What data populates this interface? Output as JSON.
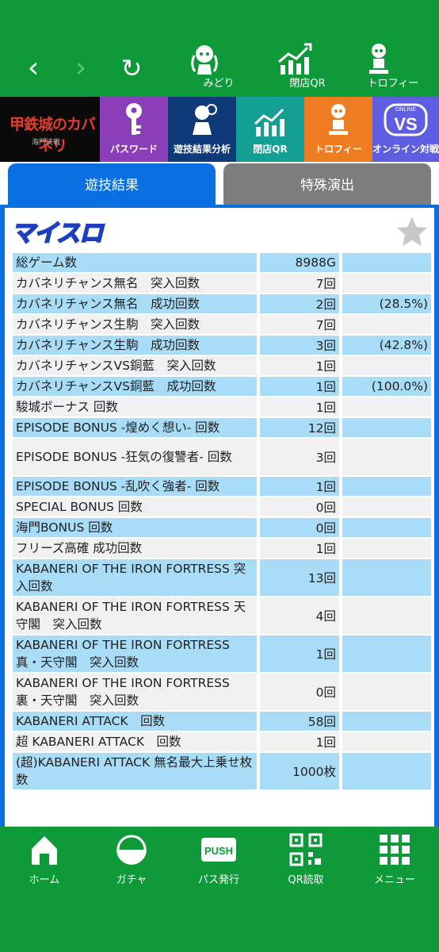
{
  "nav": {
    "back_glyph": "‹",
    "forward_glyph": "›",
    "reload_glyph": "↻"
  },
  "top_icons": [
    {
      "label": "みどり",
      "icon": "character-icon"
    },
    {
      "label": "閉店QR",
      "icon": "chart-icon"
    },
    {
      "label": "トロフィー",
      "icon": "trophy-icon"
    }
  ],
  "menu": {
    "logo_text": "甲鉄城のカバネリ",
    "logo_sub": "海門決戦",
    "tiles": [
      {
        "label": "パスワード",
        "color": "#8a3fb8"
      },
      {
        "label": "遊技結果分析",
        "color": "#0e3a7a"
      },
      {
        "label": "閉店QR",
        "color": "#149f94"
      },
      {
        "label": "トロフィー",
        "color": "#ee7d22"
      },
      {
        "label": "オンライン対戦",
        "color": "#5f5ee3"
      }
    ],
    "vs_text": "VS",
    "online_text": "ONLINE"
  },
  "tabs": {
    "active": "遊技結果",
    "inactive": "特殊演出"
  },
  "brand": "マイスロ",
  "rows": [
    {
      "name": "総ゲーム数",
      "value": "8988G",
      "pct": ""
    },
    {
      "name": "カバネリチャンス無名　突入回数",
      "value": "7回",
      "pct": ""
    },
    {
      "name": "カバネリチャンス無名　成功回数",
      "value": "2回",
      "pct": "(28.5%)"
    },
    {
      "name": "カバネリチャンス生駒　突入回数",
      "value": "7回",
      "pct": ""
    },
    {
      "name": "カバネリチャンス生駒　成功回数",
      "value": "3回",
      "pct": "(42.8%)"
    },
    {
      "name": "カバネリチャンスVS銅藍　突入回数",
      "value": "1回",
      "pct": ""
    },
    {
      "name": "カバネリチャンスVS銅藍　成功回数",
      "value": "1回",
      "pct": "(100.0%)"
    },
    {
      "name": "駿城ボーナス 回数",
      "value": "1回",
      "pct": ""
    },
    {
      "name": "EPISODE BONUS -煌めく想い- 回数",
      "value": "12回",
      "pct": ""
    },
    {
      "name": "EPISODE BONUS -狂気の復讐者- 回数",
      "value": "3回",
      "pct": ""
    },
    {
      "name": "EPISODE BONUS -乱吹く強者- 回数",
      "value": "1回",
      "pct": ""
    },
    {
      "name": "SPECIAL BONUS 回数",
      "value": "0回",
      "pct": ""
    },
    {
      "name": "海門BONUS 回数",
      "value": "0回",
      "pct": ""
    },
    {
      "name": "フリーズ高確 成功回数",
      "value": "1回",
      "pct": ""
    },
    {
      "name": "KABANERI OF THE IRON FORTRESS 突入回数",
      "value": "13回",
      "pct": ""
    },
    {
      "name": "KABANERI OF THE IRON FORTRESS 天守閣　突入回数",
      "value": "4回",
      "pct": ""
    },
    {
      "name": "KABANERI OF THE IRON FORTRESS 真・天守閣　突入回数",
      "value": "1回",
      "pct": ""
    },
    {
      "name": "KABANERI OF THE IRON FORTRESS 裏・天守閣　突入回数",
      "value": "0回",
      "pct": ""
    },
    {
      "name": "KABANERI ATTACK　回数",
      "value": "58回",
      "pct": ""
    },
    {
      "name": "超 KABANERI ATTACK　回数",
      "value": "1回",
      "pct": ""
    },
    {
      "name": "(超)KABANERI ATTACK 無名最大上乗せ枚数",
      "value": "1000枚",
      "pct": ""
    }
  ],
  "bottom_nav": [
    {
      "label": "ホーム",
      "icon": "home-icon"
    },
    {
      "label": "ガチャ",
      "icon": "gacha-icon"
    },
    {
      "label": "パス発行",
      "icon": "push-icon"
    },
    {
      "label": "QR読取",
      "icon": "qr-icon"
    },
    {
      "label": "メニュー",
      "icon": "menu-grid-icon"
    }
  ],
  "push_text": "PUSH",
  "colors": {
    "green": "#0f9a3a",
    "blue": "#0a6fe0",
    "row_blue": "#a8dcf7",
    "row_gray": "#f1f1f1"
  }
}
